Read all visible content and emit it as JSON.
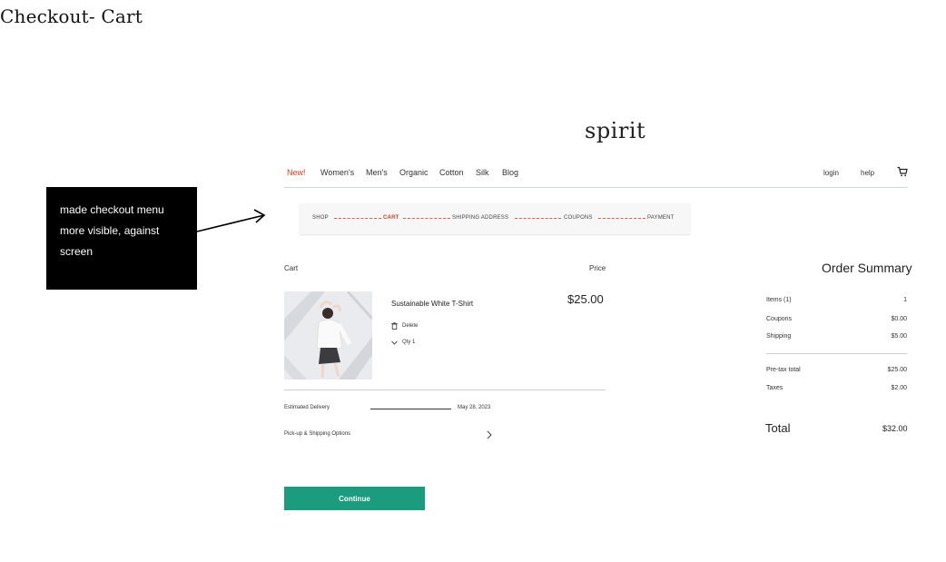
{
  "page": {
    "title": "Checkout- Cart"
  },
  "annotation": {
    "lines": [
      "made checkout menu",
      "more visible, against",
      "screen"
    ]
  },
  "brand": {
    "logo": "spirit"
  },
  "nav": {
    "items": [
      "New!",
      "Women's",
      "Men's",
      "Organic",
      "Cotton",
      "Silk",
      "Blog"
    ],
    "login": "login",
    "help": "help"
  },
  "steps": [
    "SHOP",
    "CART",
    "SHIPPING ADDRESS",
    "COUPONS",
    "PAYMENT"
  ],
  "cart": {
    "heading": "Cart",
    "price_heading": "Price",
    "item": {
      "name": "Sustainable White T-Shirt",
      "price": "$25.00",
      "delete_label": "Delete",
      "qty_label": "Qty 1"
    },
    "delivery_label": "Estimated Delivery",
    "delivery_date": "May 28, 2023",
    "pickup_label": "Pick-up & Shipping Options",
    "continue_label": "Continue"
  },
  "summary": {
    "title": "Order Summary",
    "rows": [
      {
        "label": "Items (1)",
        "value": "1"
      },
      {
        "label": "Coupons",
        "value": "$0.00"
      },
      {
        "label": "Shipping",
        "value": "$5.00"
      },
      {
        "label": "Pre-tax total",
        "value": "$25.00"
      },
      {
        "label": "Taxes",
        "value": "$2.00"
      }
    ],
    "total_label": "Total",
    "total_value": "$32.00"
  },
  "colors": {
    "accent": "#e03a1e",
    "button": "#1b9c7e"
  }
}
